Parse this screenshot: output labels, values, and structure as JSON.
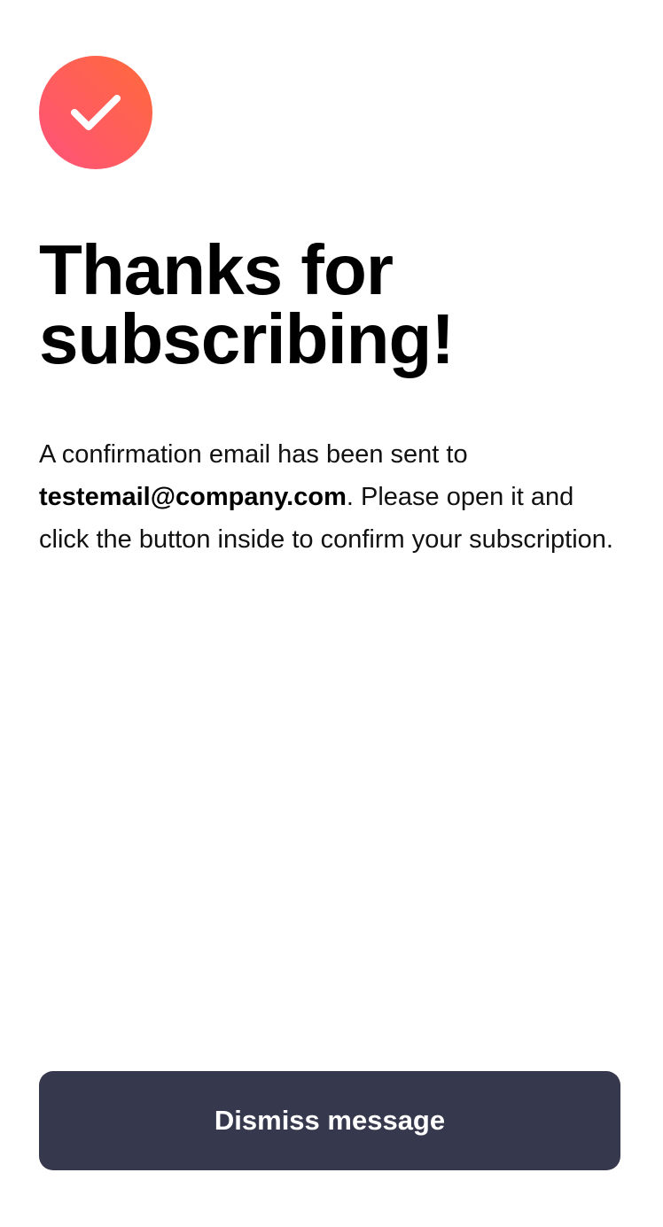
{
  "icon": {
    "name": "checkmark-icon",
    "gradient_start": "#FF6A3A",
    "gradient_end": "#FF527B"
  },
  "title": "Thanks for subscribing!",
  "message": {
    "before_email": "A confirmation email has been sent to ",
    "email": "testemail@company.com",
    "after_email": ". Please open it and click the button inside to confirm your subscription."
  },
  "dismiss_button": {
    "label": "Dismiss message",
    "background": "#36384D"
  }
}
